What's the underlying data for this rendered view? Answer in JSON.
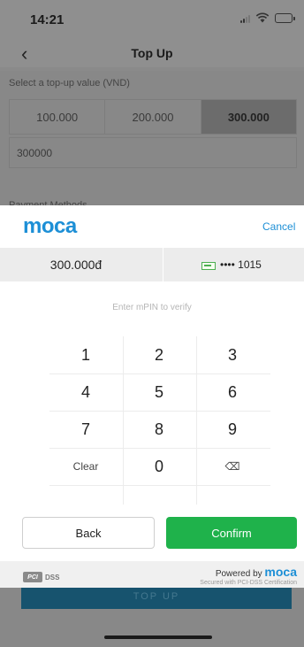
{
  "status_bar": {
    "time": "14:21"
  },
  "nav": {
    "back_icon": "chevron-left-icon",
    "title": "Top Up"
  },
  "topup": {
    "select_label": "Select a top-up value (VND)",
    "options": [
      "100.000",
      "200.000",
      "300.000"
    ],
    "selected_index": 2,
    "amount_value": "300000",
    "payment_label": "Payment Methods",
    "topup_button_label": "TOP UP"
  },
  "modal": {
    "logo": "moca",
    "cancel_label": "Cancel",
    "amount": "300.000đ",
    "card_mask": "•••• 1015",
    "prompt": "Enter mPIN to verify",
    "keypad": [
      "1",
      "2",
      "3",
      "4",
      "5",
      "6",
      "7",
      "8",
      "9",
      "Clear",
      "0",
      "⌫"
    ],
    "back_label": "Back",
    "confirm_label": "Confirm",
    "footer": {
      "pci_badge": "PCI",
      "pci_dss": "DSS",
      "powered_by": "Powered by",
      "brand": "moca",
      "secured": "Secured with PCI-DSS Certification"
    }
  },
  "colors": {
    "brand_blue": "#1d8fd6",
    "confirm_green": "#1fb24b"
  }
}
